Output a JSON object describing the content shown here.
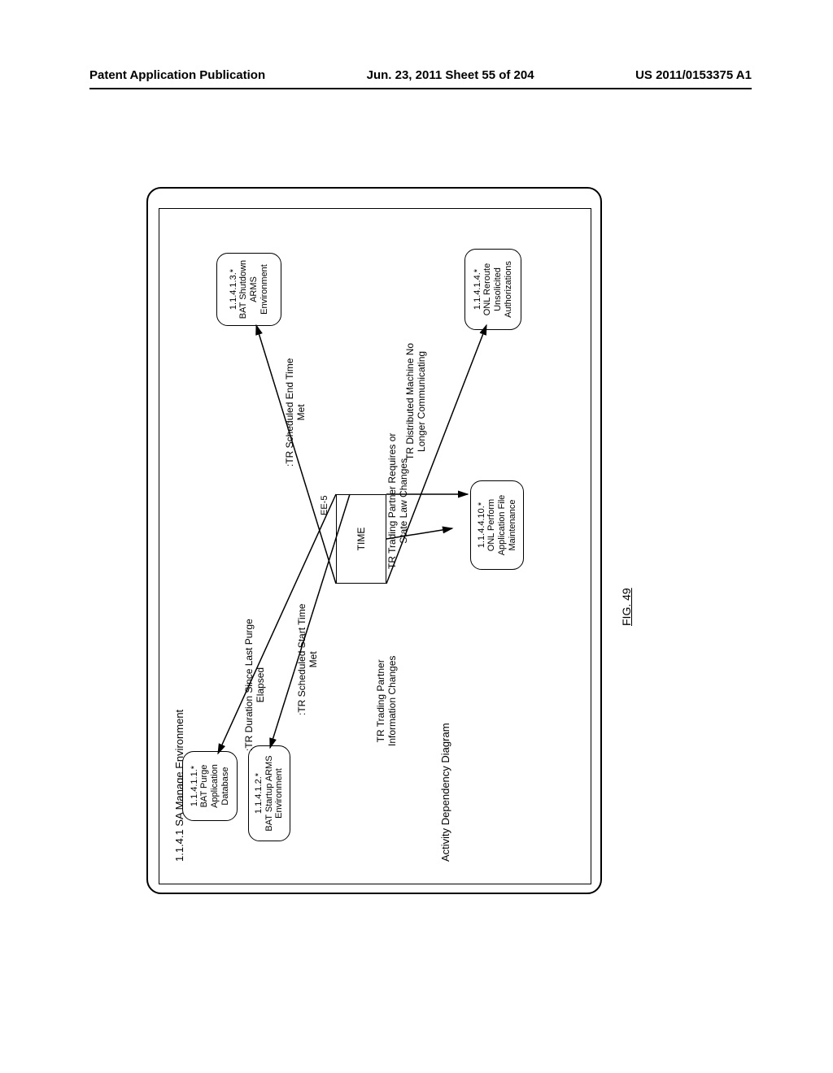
{
  "header": {
    "left": "Patent Application Publication",
    "center": "Jun. 23, 2011  Sheet 55 of 204",
    "right": "US 2011/0153375 A1"
  },
  "diagram": {
    "frame_title": "1.1.4.1 SA Manage Environment",
    "dependency_title": "Activity Dependency Diagram",
    "time_node": {
      "ee_label": "EE-5",
      "label": "TIME"
    },
    "activities": {
      "a1": "1.1.4.1.1.*\nBAT Purge\nApplication\nDatabase",
      "a2": "1.1.4.1.2.*\nBAT Startup ARMS\nEnvironment",
      "a3": "1.1.4.1.3.*\nBAT Shutdown\nARMS\nEnvironment",
      "a4": "1.1.4.1.4.*\nONL Reroute\nUnsolicited\nAuthorizations",
      "a10": "1.1.4.4.10.*\nONL Perform\nApplication File\nMaintenance"
    },
    "transitions": {
      "t1": ":TR Duration Since Last Purge\nElapsed",
      "t2": ":TR Scheduled Start Time\nMet",
      "t3": ":TR  Scheduled End Time\nMet",
      "t4": "TR Trading Partner\nInformation Changes",
      "t5": "TR Trading Partner Requires or\nState Law Changes",
      "t6": "TR Distributed Machine No\nLonger Communicating"
    }
  },
  "figure_label": "FIG. 49"
}
